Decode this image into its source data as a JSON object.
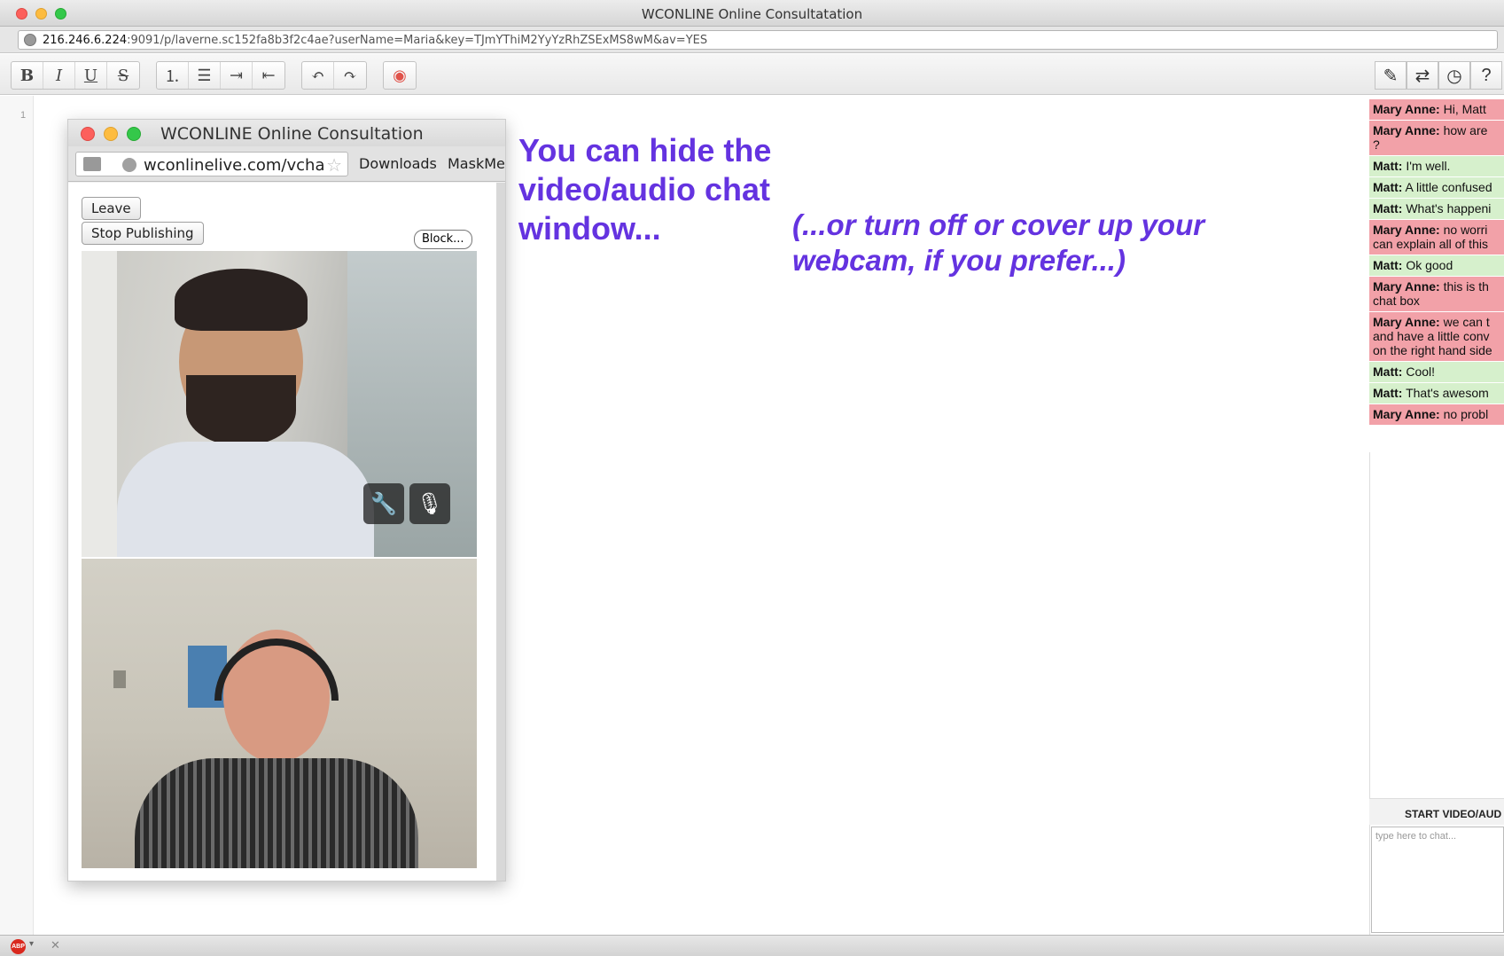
{
  "window": {
    "title": "WCONLINE Online Consultatation"
  },
  "address_bar": {
    "host": "216.246.6.224",
    "path": ":9091/p/laverne.sc152fa8b3f2c4ae?userName=Maria&key=TJmYThiM2YyYzRhZSExMS8wM&av=YES"
  },
  "toolbar": {
    "bold": "B",
    "italic": "I",
    "underline": "U",
    "strike": "S",
    "ordered_list": "⒈",
    "bullet_list": "☰",
    "indent": "⇥",
    "outdent": "⇤",
    "undo": "↶",
    "redo": "↷",
    "color": "◉"
  },
  "editor": {
    "line_number": "1"
  },
  "video_window": {
    "title": "WCONLINE Online Consultation",
    "url": "wconlinelive.com/vcha",
    "bookmarks": [
      "Downloads",
      "MaskMe"
    ],
    "leave_label": "Leave",
    "stop_publishing_label": "Stop Publishing",
    "block_label": "Block..."
  },
  "annotations": {
    "main": "You can hide the video/audio chat window...",
    "aside": "(...or turn off or cover up your webcam, if you prefer...)"
  },
  "sidebar_tools": [
    "✎",
    "⇄",
    "◷",
    "?"
  ],
  "chat": {
    "messages": [
      {
        "who": "Mary Anne:",
        "text": " Hi, Matt",
        "color": "pink"
      },
      {
        "who": "Mary Anne:",
        "text": " how are",
        "extra": "?",
        "color": "pink"
      },
      {
        "who": "Matt:",
        "text": " I'm well.",
        "color": "green"
      },
      {
        "who": "Matt:",
        "text": " A little confused",
        "color": "green"
      },
      {
        "who": "Matt:",
        "text": " What's happeni",
        "color": "green"
      },
      {
        "who": "Mary Anne:",
        "text": " no worri",
        "extra": "can explain all of this",
        "color": "pink"
      },
      {
        "who": "Matt:",
        "text": " Ok good",
        "color": "green"
      },
      {
        "who": "Mary Anne:",
        "text": " this is th",
        "extra": "chat box",
        "color": "pink"
      },
      {
        "who": "Mary Anne:",
        "text": " we can t",
        "extra": "and have a little conv",
        "extra2": "on the right hand side",
        "color": "pink"
      },
      {
        "who": "Matt:",
        "text": " Cool!",
        "color": "green"
      },
      {
        "who": "Matt:",
        "text": " That's awesom",
        "color": "green"
      },
      {
        "who": "Mary Anne:",
        "text": " no probl",
        "color": "pink"
      }
    ],
    "start_video_label": "START VIDEO/AUD",
    "input_placeholder": "type here to chat..."
  },
  "statusbar": {
    "abp": "ABP",
    "arrow": "▾",
    "close": "✕"
  }
}
